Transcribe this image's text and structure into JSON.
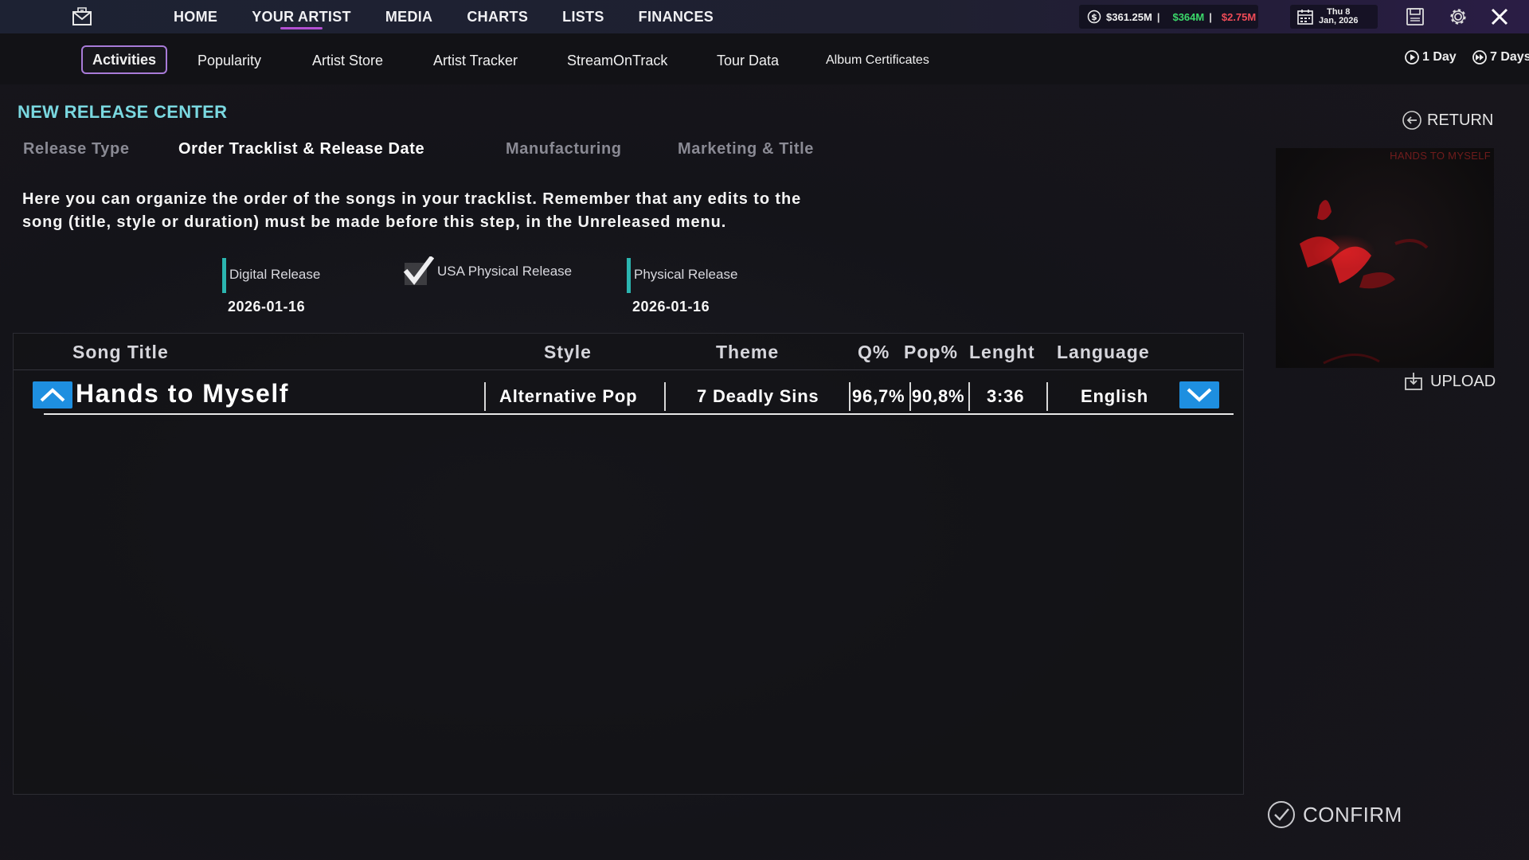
{
  "topnav": {
    "items": [
      "HOME",
      "YOUR ARTIST",
      "MEDIA",
      "CHARTS",
      "LISTS",
      "FINANCES"
    ],
    "active_index": 1
  },
  "status": {
    "money_total": "$361.25M",
    "money_income": "$364M",
    "money_expense": "$2.75M",
    "date_line1": "Thu 8",
    "date_line2": "Jan, 2026"
  },
  "subtabs": [
    "Activities",
    "Popularity",
    "Artist Store",
    "Artist Tracker",
    "StreamOnTrack",
    "Tour Data",
    "Album Certificates"
  ],
  "time_controls": {
    "one_day": "1 Day",
    "seven_days": "7 Days"
  },
  "page": {
    "title": "NEW RELEASE CENTER",
    "steps": [
      "Release Type",
      "Order Tracklist & Release Date",
      "Manufacturing",
      "Marketing & Title"
    ],
    "active_step": 1,
    "return_label": "RETURN",
    "description_line1": "Here you can organize the order of the songs in your tracklist. Remember that any edits to the",
    "description_line2": "song (title, style or duration) must be made before this step, in the Unreleased menu."
  },
  "release": {
    "digital_label": "Digital Release",
    "digital_date": "2026-01-16",
    "usa_physical_label": "USA Physical Release",
    "usa_physical_checked": true,
    "physical_label": "Physical Release",
    "physical_date": "2026-01-16"
  },
  "table": {
    "headers": [
      "Song Title",
      "Style",
      "Theme",
      "Q%",
      "Pop%",
      "Lenght",
      "Language"
    ],
    "rows": [
      {
        "title": "Hands to Myself",
        "style": "Alternative Pop",
        "theme": "7 Deadly Sins",
        "quality": "96,7%",
        "popularity": "90,8%",
        "length": "3:36",
        "language": "English"
      }
    ]
  },
  "cover": {
    "title": "HANDS TO MYSELF"
  },
  "actions": {
    "upload_label": "UPLOAD",
    "confirm_label": "CONFIRM"
  },
  "colors": {
    "accent_cyan": "#7ad8e0",
    "accent_purple": "#b14fd1",
    "teal_bar": "#2bb5b0",
    "arrow_blue": "#1e8fe0",
    "money_green": "#3bd86a",
    "money_red": "#ef4b57"
  },
  "icons": [
    "mail-icon",
    "dollar-icon",
    "calendar-icon",
    "save-icon",
    "gear-icon",
    "close-icon",
    "clock-icon",
    "fast-forward-clock-icon",
    "return-icon",
    "upload-icon",
    "checkmark-icon",
    "check-circle-icon",
    "chevron-up-icon",
    "chevron-down-icon"
  ]
}
